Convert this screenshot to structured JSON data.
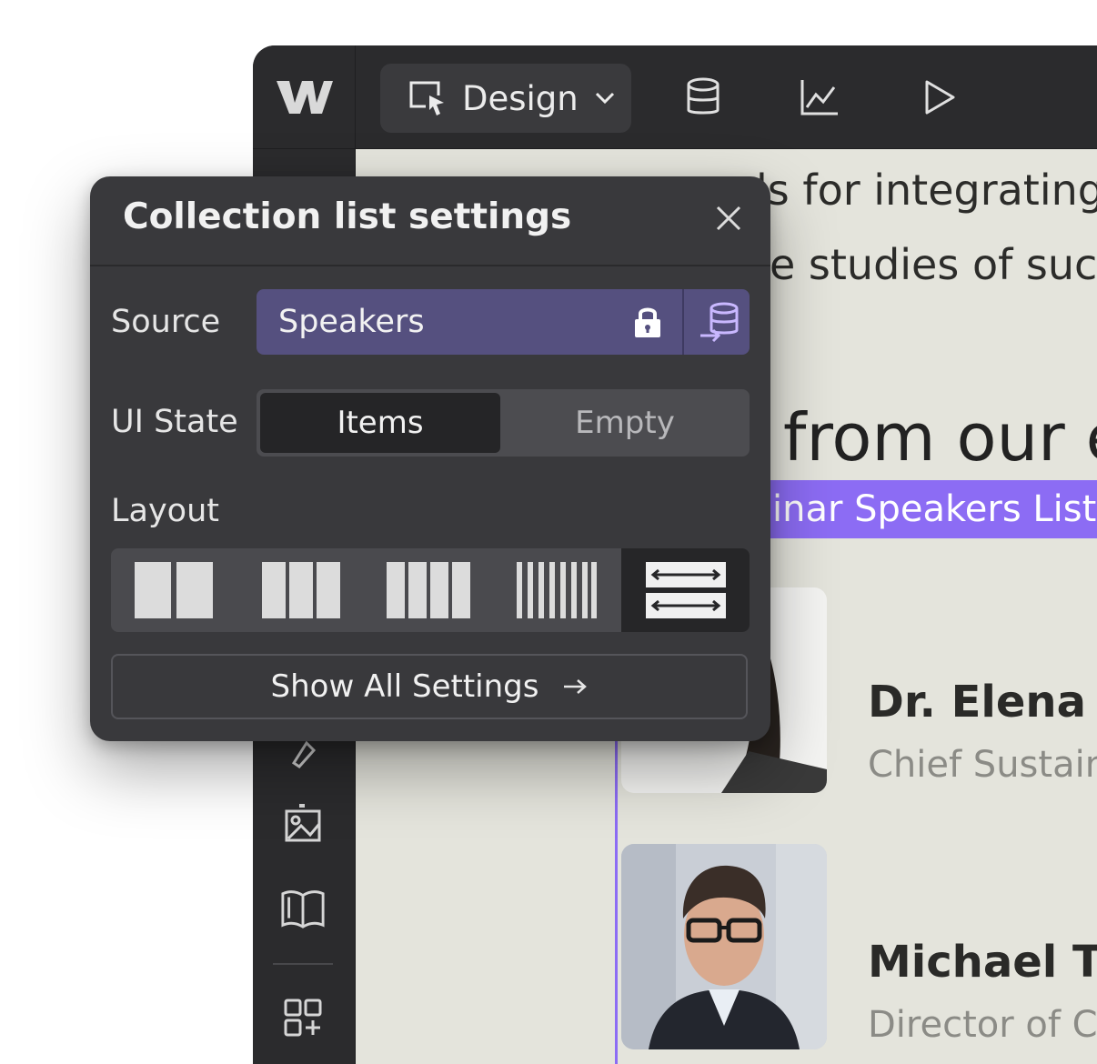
{
  "toolbar": {
    "mode_label": "Design"
  },
  "canvas": {
    "line1": "ls for integrating",
    "line2": "e studies of suc",
    "heading": "from our e",
    "collection_list_label": "inar Speakers List",
    "speakers": [
      {
        "name": "Dr. Elena M",
        "role": "Chief Sustain"
      },
      {
        "name": "Michael Th",
        "role": "Director of Cl"
      }
    ]
  },
  "popover": {
    "title": "Collection list settings",
    "source": {
      "label": "Source",
      "value": "Speakers"
    },
    "ui_state": {
      "label": "UI State",
      "options": [
        "Items",
        "Empty"
      ],
      "selected": "Items"
    },
    "layout": {
      "label": "Layout",
      "selected_index": 4
    },
    "show_all_label": "Show All Settings"
  },
  "colors": {
    "accent_purple": "#8c6cf4",
    "source_field": "#55507f",
    "panel_bg": "#39393c"
  }
}
